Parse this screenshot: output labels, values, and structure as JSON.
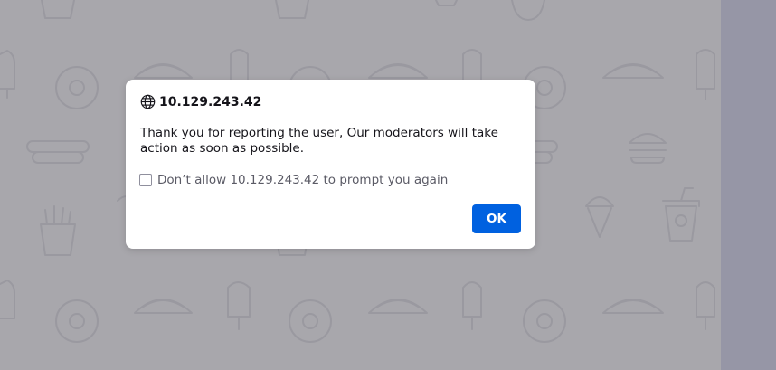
{
  "dialog": {
    "origin": "10.129.243.42",
    "message": "Thank you for reporting the user, Our moderators will take action as soon as possible.",
    "checkbox_label": "Don’t allow 10.129.243.42 to prompt you again",
    "checkbox_checked": false,
    "ok_label": "OK"
  },
  "colors": {
    "overlay": "#a8a7ac",
    "side_strip": "#9696a6",
    "primary_button": "#0061e0",
    "dialog_bg": "#ffffff"
  },
  "icons": {
    "origin": "globe-icon",
    "pattern": [
      "popsicle-icon",
      "donut-icon",
      "taco-icon",
      "hotdog-icon",
      "burger-icon",
      "fries-icon",
      "ice-cream-icon",
      "drink-cup-icon"
    ]
  }
}
